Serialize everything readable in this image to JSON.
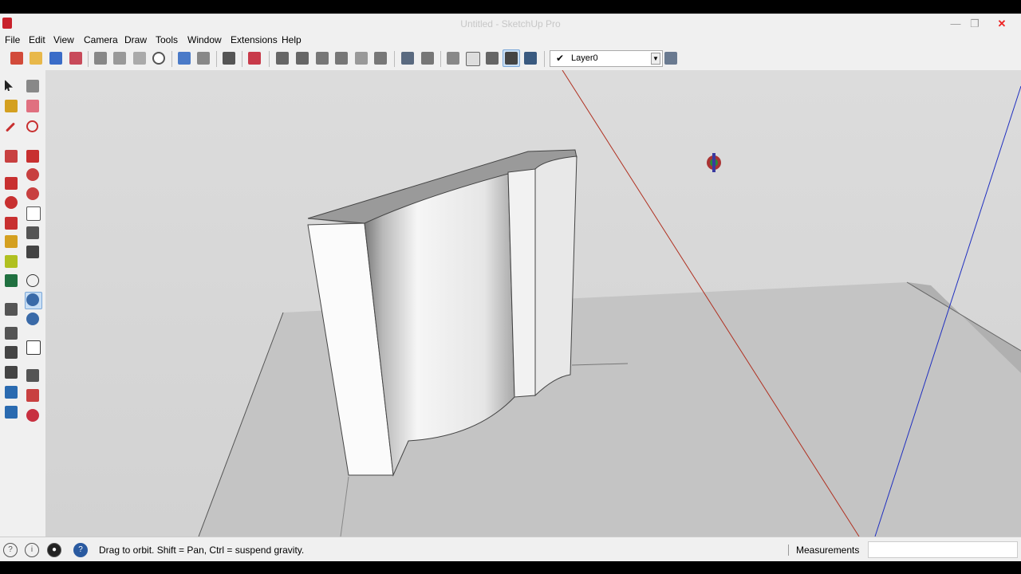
{
  "window": {
    "title": "Untitled - SketchUp Pro",
    "minimize": "—",
    "maximize": "❐",
    "close": "✕"
  },
  "menu": {
    "items": [
      "File",
      "Edit",
      "View",
      "Camera",
      "Draw",
      "Tools",
      "Window",
      "Extensions",
      "Help"
    ]
  },
  "layer": {
    "name": "Layer0",
    "check": "✔",
    "dropdown": "▼"
  },
  "status": {
    "message": "Drag to orbit. Shift = Pan, Ctrl = suspend gravity.",
    "measurements_label": "Measurements",
    "measurements_value": ""
  },
  "colors": {
    "red_axis": "#b03020",
    "blue_axis": "#2030c0",
    "ground": "#c6c6c6",
    "sky": "#d8d8d8",
    "active_tool_bg": "#c9dff5"
  }
}
